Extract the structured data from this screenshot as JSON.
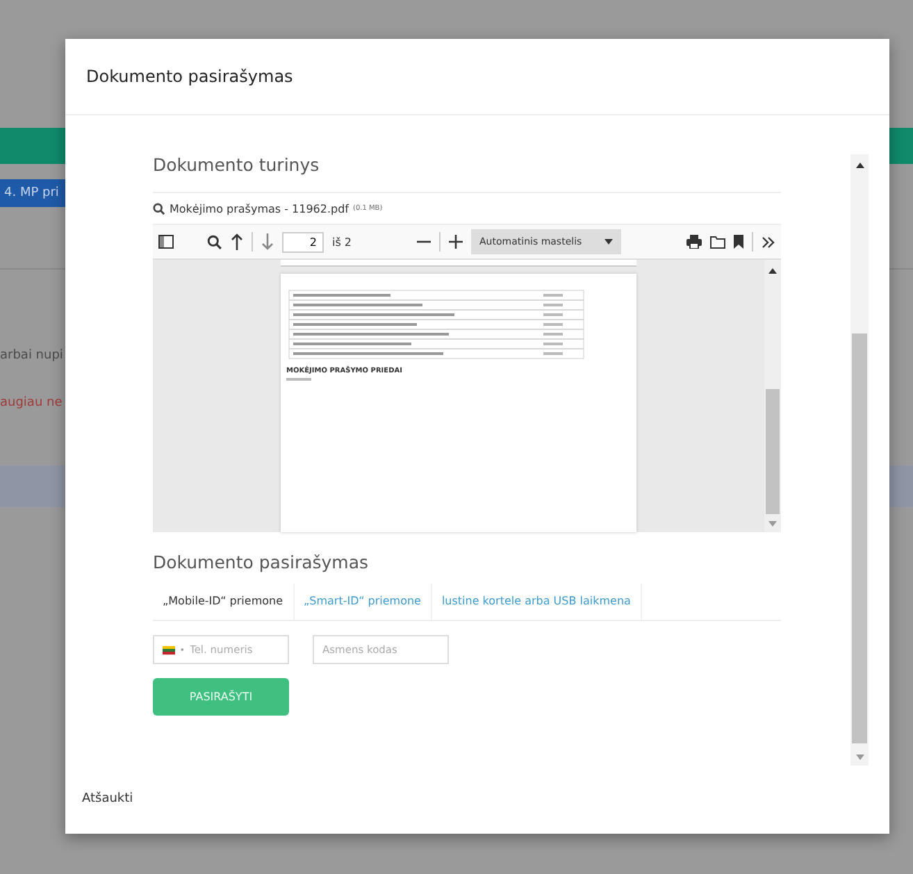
{
  "background": {
    "tab_label": "4. MP pri",
    "texts": [
      {
        "text": "arbai nupi",
        "kind": "plain"
      },
      {
        "text": "augiau ne",
        "kind": "error"
      }
    ]
  },
  "modal": {
    "title": "Dokumento pasirašymas",
    "content_heading": "Dokumento turinys",
    "file": {
      "name": "Mokėjimo prašymas - 11962.pdf",
      "size": "(0.1 MB)"
    },
    "viewer": {
      "page": "2",
      "page_total": "iš 2",
      "zoom": "Automatinis mastelis",
      "document_heading": "MOKĖJIMO PRAŠYMO PRIEDAI"
    },
    "signing_heading": "Dokumento pasirašymas",
    "tabs": [
      {
        "label": "„Mobile-ID“ priemone",
        "selected": true
      },
      {
        "label": "„Smart-ID“ priemone",
        "selected": false
      },
      {
        "label": "lustine kortele arba USB laikmena",
        "selected": false
      }
    ],
    "phone_field": {
      "placeholder": "Tel. numeris"
    },
    "id_field": {
      "placeholder": "Asmens kodas"
    },
    "sign_button": "PASIRAŠYTI",
    "cancel": "Atšaukti"
  }
}
